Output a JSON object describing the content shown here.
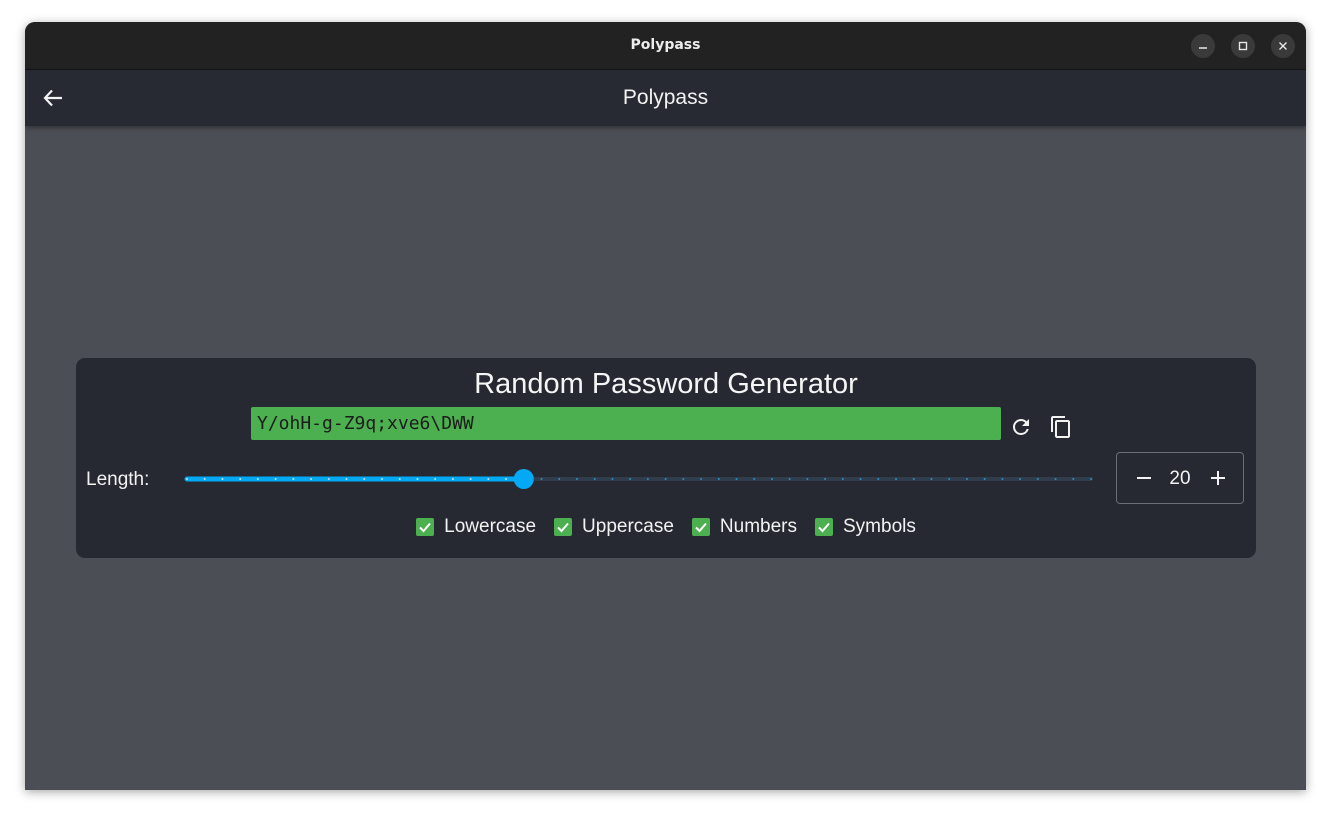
{
  "window": {
    "title": "Polypass",
    "controls": [
      "minimize-icon",
      "maximize-icon",
      "close-icon"
    ]
  },
  "appbar": {
    "title": "Polypass",
    "back_icon": "arrow-left-icon"
  },
  "generator": {
    "title": "Random Password Generator",
    "password": "Y/ohH-g-Z9q;xve6\\DWW",
    "regenerate_icon": "refresh-icon",
    "copy_icon": "copy-icon",
    "length_label": "Length:",
    "length_value": "20",
    "slider": {
      "min": 1,
      "max": 52,
      "value": 20
    },
    "options": [
      {
        "label": "Lowercase",
        "checked": true
      },
      {
        "label": "Uppercase",
        "checked": true
      },
      {
        "label": "Numbers",
        "checked": true
      },
      {
        "label": "Symbols",
        "checked": true
      }
    ]
  },
  "colors": {
    "accent": "#03a9f4",
    "password_bg": "#4caf50",
    "card_bg": "#262932",
    "page_bg": "#4b4e54"
  }
}
